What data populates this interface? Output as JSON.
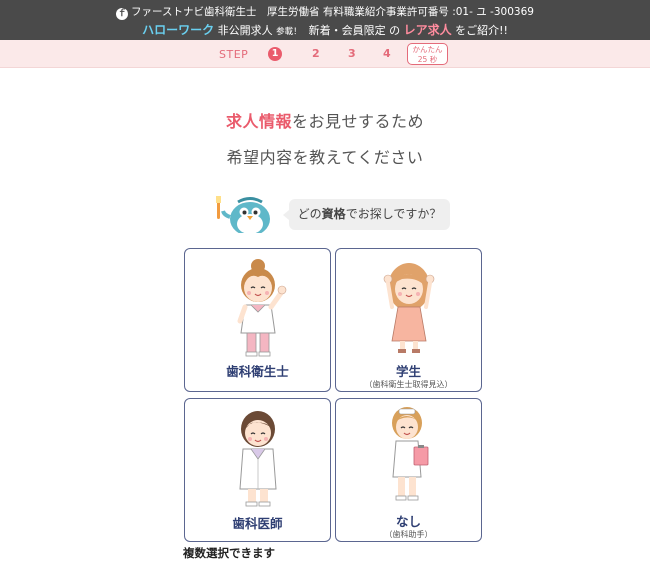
{
  "header": {
    "line1": "ファーストナビ歯科衛生士　厚生労働省 有料職業紹介事業許可番号 :01- ユ -300369",
    "hellowork": "ハローワーク",
    "nonpublic": "非公開求人",
    "joined": "参載！",
    "limited": "新着・会員限定 の",
    "rare": "レア求人",
    "intro": "をご紹介!!"
  },
  "steps": {
    "label": "STEP",
    "current": "1",
    "others": [
      "2",
      "3",
      "4"
    ],
    "time_line1": "かんたん",
    "time_line2": "25 秒"
  },
  "headline": {
    "highlight": "求人情報",
    "rest1": "をお見せするため",
    "line2": "希望内容を教えてください"
  },
  "question": {
    "pre": "どの",
    "strong": "資格",
    "post": "でお探しですか？"
  },
  "options": [
    {
      "name": "歯科衛生士",
      "sub": ""
    },
    {
      "name": "学生",
      "sub": "（歯科衛生士取得見込）"
    },
    {
      "name": "歯科医師",
      "sub": ""
    },
    {
      "name": "なし",
      "sub": "（歯科助手）"
    }
  ],
  "footer_note": "複数選択できます",
  "colors": {
    "accent": "#ea5b6c",
    "card_border": "#5b6690",
    "card_text": "#2f3f73",
    "topbar": "#4a4a4a",
    "stepbar": "#fbe9e9"
  }
}
